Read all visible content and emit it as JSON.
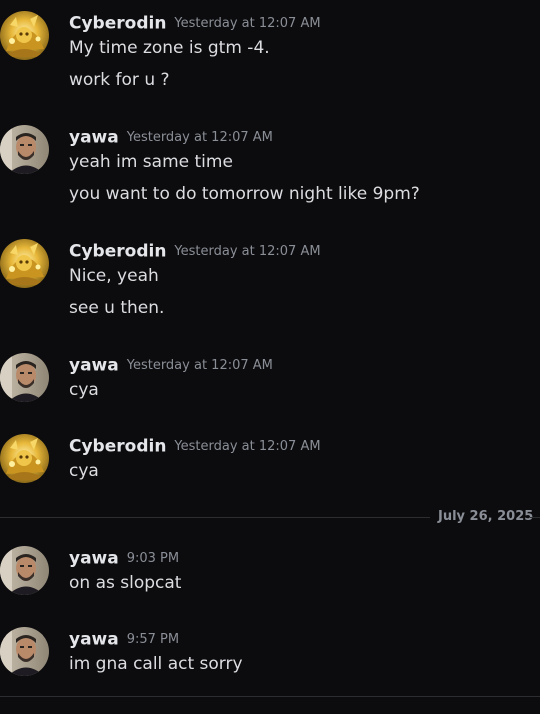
{
  "messages": [
    {
      "username": "Cyberodin",
      "timestamp": "Yesterday at 12:07 AM",
      "avatar": "golden-character-avatar",
      "lines": [
        "My time zone is gtm -4.",
        "work for u ?"
      ]
    },
    {
      "username": "yawa",
      "timestamp": "Yesterday at 12:07 AM",
      "avatar": "man-portrait-avatar",
      "lines": [
        "yeah im same time",
        "you want to do tomorrow night like 9pm?"
      ]
    },
    {
      "username": "Cyberodin",
      "timestamp": "Yesterday at 12:07 AM",
      "avatar": "golden-character-avatar",
      "lines": [
        "Nice, yeah",
        "see u then."
      ]
    },
    {
      "username": "yawa",
      "timestamp": "Yesterday at 12:07 AM",
      "avatar": "man-portrait-avatar",
      "lines": [
        "cya"
      ]
    },
    {
      "username": "Cyberodin",
      "timestamp": "Yesterday at 12:07 AM",
      "avatar": "golden-character-avatar",
      "lines": [
        "cya"
      ]
    },
    {
      "username": "yawa",
      "timestamp": "9:03 PM",
      "avatar": "man-portrait-avatar",
      "lines": [
        "on as slopcat"
      ]
    },
    {
      "username": "yawa",
      "timestamp": "9:57 PM",
      "avatar": "man-portrait-avatar",
      "lines": [
        "im gna call act sorry"
      ]
    }
  ],
  "date_divider": "July 26, 2025",
  "colors": {
    "background": "#0c0c0e",
    "username": "#e4e6ea",
    "timestamp": "#8a8e96",
    "message_text": "#dcdde1",
    "divider": "#2b2d31"
  }
}
